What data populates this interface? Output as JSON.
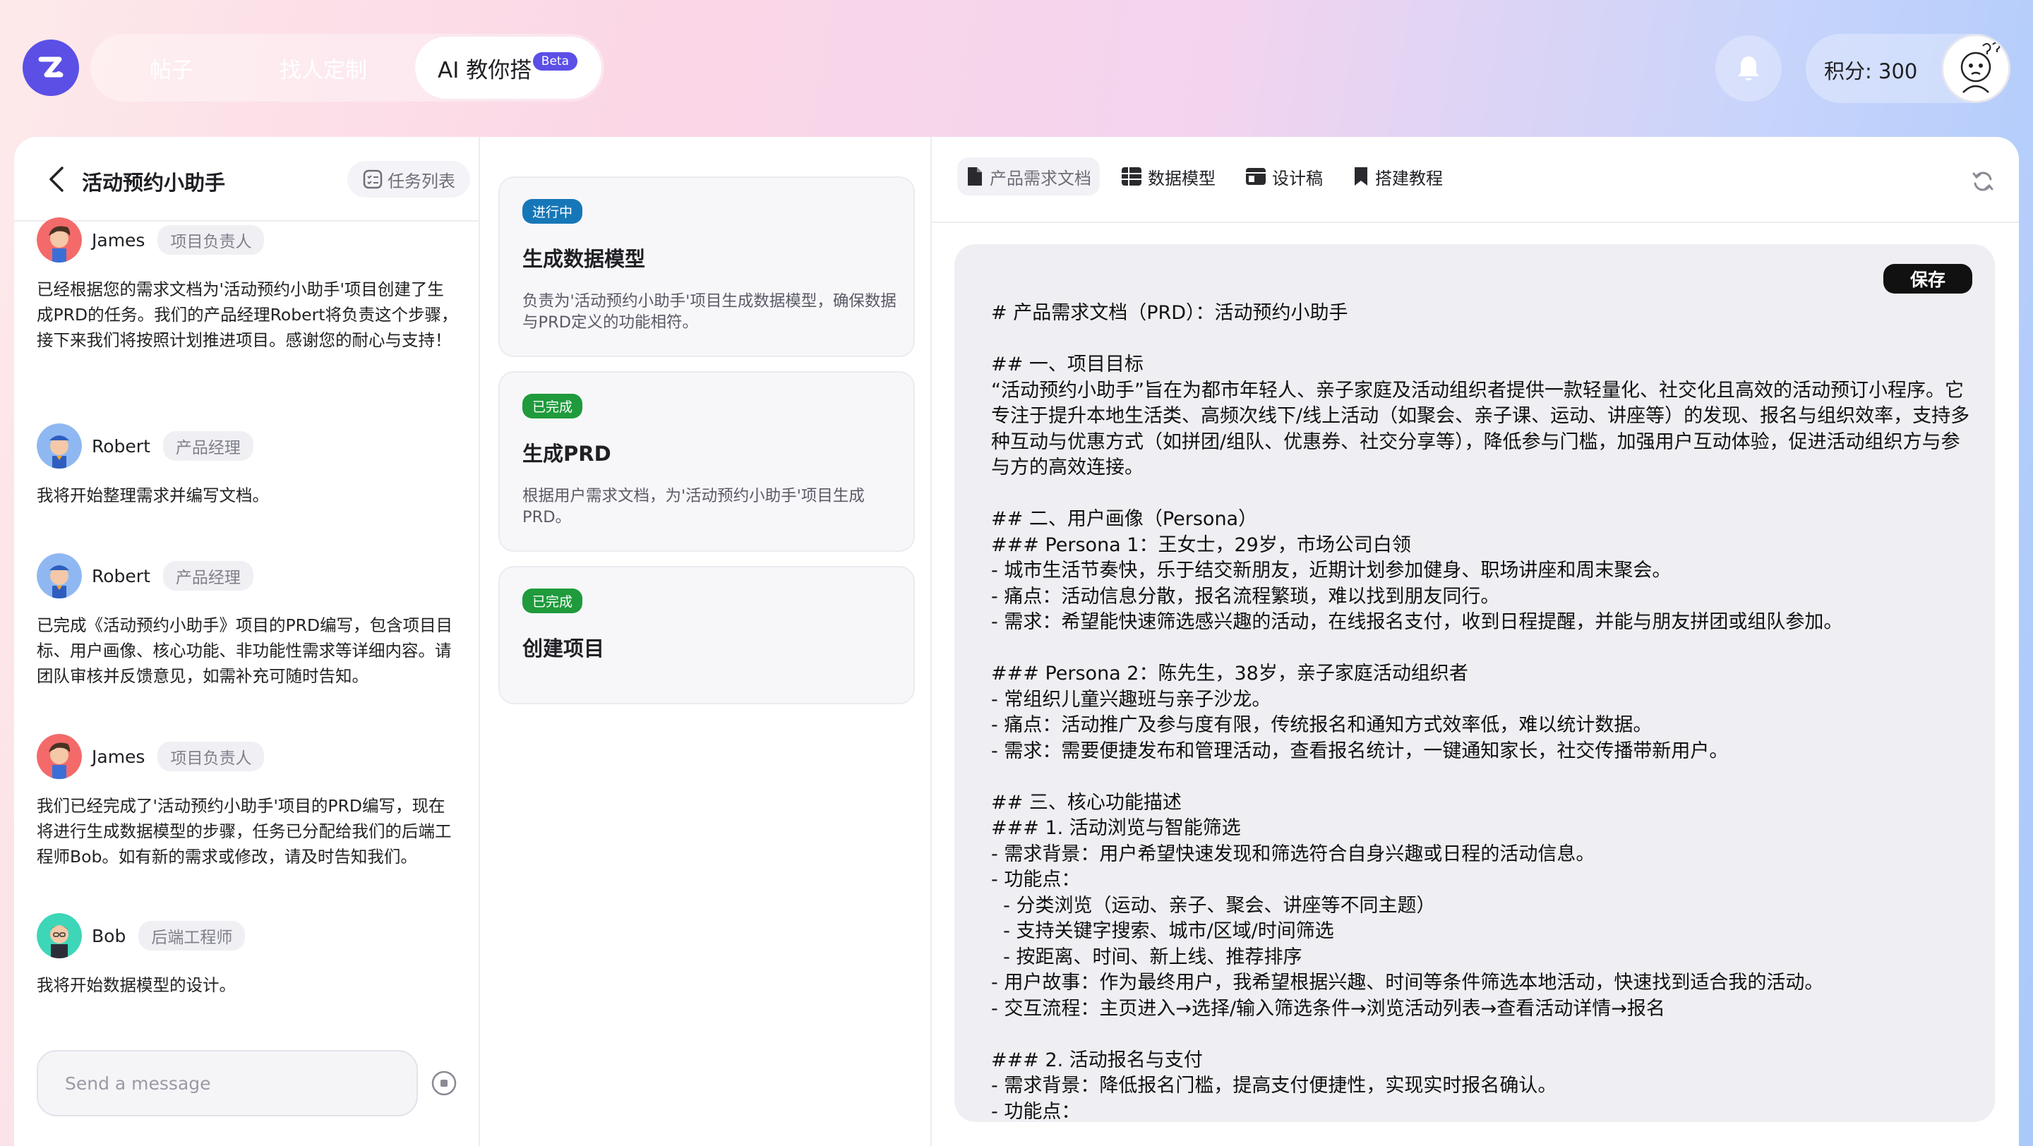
{
  "nav": {
    "tabs": [
      {
        "label": "帖子"
      },
      {
        "label": "找人定制"
      },
      {
        "label": "AI 教你搭"
      }
    ],
    "beta_badge": "Beta",
    "points_label": "积分: 300"
  },
  "left": {
    "title": "活动预约小助手",
    "task_list_label": "任务列表",
    "messages": [
      {
        "name": "James",
        "role": "项目负责人",
        "text": "已经根据您的需求文档为'活动预约小助手'项目创建了生成PRD的任务。我们的产品经理Robert将负责这个步骤，接下来我们将按照计划推进项目。感谢您的耐心与支持！"
      },
      {
        "name": "Robert",
        "role": "产品经理",
        "text": "我将开始整理需求并编写文档。"
      },
      {
        "name": "Robert",
        "role": "产品经理",
        "text": "已完成《活动预约小助手》项目的PRD编写，包含项目目标、用户画像、核心功能、非功能性需求等详细内容。请团队审核并反馈意见，如需补充可随时告知。"
      },
      {
        "name": "James",
        "role": "项目负责人",
        "text": "我们已经完成了'活动预约小助手'项目的PRD编写，现在将进行生成数据模型的步骤，任务已分配给我们的后端工程师Bob。如有新的需求或修改，请及时告知我们。"
      },
      {
        "name": "Bob",
        "role": "后端工程师",
        "text": "我将开始数据模型的设计。"
      }
    ],
    "composer_placeholder": "Send a message"
  },
  "tasks": [
    {
      "status": "进行中",
      "title": "生成数据模型",
      "desc": "负责为'活动预约小助手'项目生成数据模型，确保数据与PRD定义的功能相符。"
    },
    {
      "status": "已完成",
      "title": "生成PRD",
      "desc": "根据用户需求文档，为'活动预约小助手'项目生成PRD。"
    },
    {
      "status": "已完成",
      "title": "创建项目",
      "desc": ""
    }
  ],
  "right": {
    "tabs": [
      {
        "label": "产品需求文档"
      },
      {
        "label": "数据模型"
      },
      {
        "label": "设计稿"
      },
      {
        "label": "搭建教程"
      }
    ],
    "save_label": "保存",
    "doc_text": "# 产品需求文档（PRD）：活动预约小助手\n\n## 一、项目目标\n“活动预约小助手”旨在为都市年轻人、亲子家庭及活动组织者提供一款轻量化、社交化且高效的活动预订小程序。它专注于提升本地生活类、高频次线下/线上活动（如聚会、亲子课、运动、讲座等）的发现、报名与组织效率，支持多种互动与优惠方式（如拼团/组队、优惠券、社交分享等），降低参与门槛，加强用户互动体验，促进活动组织方与参与方的高效连接。\n\n## 二、用户画像（Persona）\n### Persona 1：王女士，29岁，市场公司白领\n- 城市生活节奏快，乐于结交新朋友，近期计划参加健身、职场讲座和周末聚会。\n- 痛点：活动信息分散，报名流程繁琐，难以找到朋友同行。\n- 需求：希望能快速筛选感兴趣的活动，在线报名支付，收到日程提醒，并能与朋友拼团或组队参加。\n\n### Persona 2：陈先生，38岁，亲子家庭活动组织者\n- 常组织儿童兴趣班与亲子沙龙。\n- 痛点：活动推广及参与度有限，传统报名和通知方式效率低，难以统计数据。\n- 需求：需要便捷发布和管理活动，查看报名统计，一键通知家长，社交传播带新用户。\n\n## 三、核心功能描述\n### 1. 活动浏览与智能筛选\n- 需求背景：用户希望快速发现和筛选符合自身兴趣或日程的活动信息。\n- 功能点：\n  - 分类浏览（运动、亲子、聚会、讲座等不同主题）\n  - 支持关键字搜索、城市/区域/时间筛选\n  - 按距离、时间、新上线、推荐排序\n- 用户故事：作为最终用户，我希望根据兴趣、时间等条件筛选本地活动，快速找到适合我的活动。\n- 交互流程：主页进入→选择/输入筛选条件→浏览活动列表→查看活动详情→报名\n\n### 2. 活动报名与支付\n- 需求背景：降低报名门槛，提高支付便捷性，实现实时报名确认。\n- 功能点："
  },
  "colors": {
    "brand": "#5b4fe6",
    "in_progress": "#1677b8",
    "done": "#1f9a3c"
  }
}
